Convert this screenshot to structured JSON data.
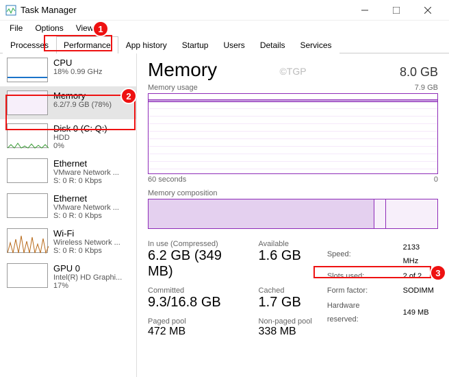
{
  "window": {
    "title": "Task Manager"
  },
  "menu": {
    "file": "File",
    "options": "Options",
    "view": "View"
  },
  "tabs": {
    "processes": "Processes",
    "performance": "Performance",
    "app_history": "App history",
    "startup": "Startup",
    "users": "Users",
    "details": "Details",
    "services": "Services"
  },
  "sidebar": {
    "cpu": {
      "title": "CPU",
      "sub": "18%  0.99 GHz"
    },
    "memory": {
      "title": "Memory",
      "sub": "6.2/7.9 GB (78%)"
    },
    "disk": {
      "title": "Disk 0 (C: Q:)",
      "sub": "HDD",
      "sub2": "0%"
    },
    "eth1": {
      "title": "Ethernet",
      "sub": "VMware Network ...",
      "sub2": "S: 0 R: 0 Kbps"
    },
    "eth2": {
      "title": "Ethernet",
      "sub": "VMware Network ...",
      "sub2": "S: 0 R: 0 Kbps"
    },
    "wifi": {
      "title": "Wi-Fi",
      "sub": "Wireless Network ...",
      "sub2": "S: 0 R: 0 Kbps"
    },
    "gpu": {
      "title": "GPU 0",
      "sub": "Intel(R) HD Graphi...",
      "sub2": "17%"
    }
  },
  "detail": {
    "heading": "Memory",
    "total": "8.0 GB",
    "watermark": "©TGP",
    "usage_label": "Memory usage",
    "usage_max": "7.9 GB",
    "axis_left": "60 seconds",
    "axis_right": "0",
    "comp_label": "Memory composition",
    "stats": {
      "in_use_label": "In use (Compressed)",
      "in_use": "6.2 GB (349 MB)",
      "available_label": "Available",
      "available": "1.6 GB",
      "committed_label": "Committed",
      "committed": "9.3/16.8 GB",
      "cached_label": "Cached",
      "cached": "1.7 GB",
      "paged_label": "Paged pool",
      "paged": "472 MB",
      "nonpaged_label": "Non-paged pool",
      "nonpaged": "338 MB"
    },
    "right": {
      "speed_label": "Speed:",
      "speed": "2133 MHz",
      "slots_label": "Slots used:",
      "slots": "2 of 2",
      "form_label": "Form factor:",
      "form": "SODIMM",
      "reserved_label": "Hardware reserved:",
      "reserved": "149 MB"
    }
  },
  "callouts": {
    "c1": "1",
    "c2": "2",
    "c3": "3"
  },
  "chart_data": {
    "type": "area",
    "title": "Memory usage",
    "x_range_seconds": [
      60,
      0
    ],
    "y_range_gb": [
      0,
      7.9
    ],
    "value_gb": 6.2,
    "composition_used_fraction": 0.78
  }
}
